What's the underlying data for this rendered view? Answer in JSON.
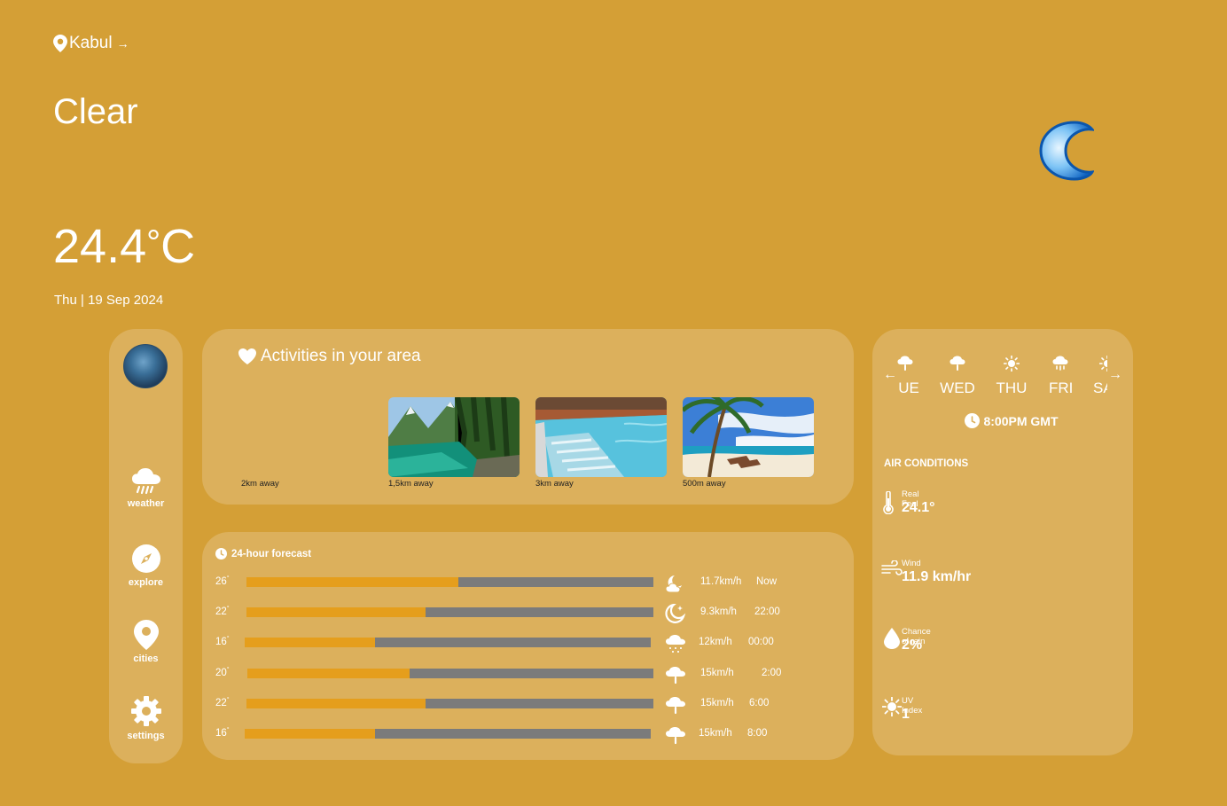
{
  "header": {
    "location": "Kabul",
    "condition": "Clear",
    "temperature": "24.4",
    "temperature_unit": "C",
    "date": "Thu | 19 Sep 2024"
  },
  "sidebar": {
    "items": [
      {
        "label": "weather",
        "icon": "rain-cloud-icon"
      },
      {
        "label": "explore",
        "icon": "compass-icon"
      },
      {
        "label": "cities",
        "icon": "map-pin-icon"
      },
      {
        "label": "settings",
        "icon": "gear-icon"
      }
    ]
  },
  "activities": {
    "title": "Activities in your area",
    "items": [
      {
        "distance": "2km away"
      },
      {
        "distance": "1,5km away"
      },
      {
        "distance": "3km away"
      },
      {
        "distance": "500m away"
      }
    ]
  },
  "forecast": {
    "title": "24-hour forecast",
    "rows": [
      {
        "temp": "26",
        "fill": 0.52,
        "wind": "11.7km/h",
        "time": "Now",
        "icon": "moon-cloud-icon"
      },
      {
        "temp": "22",
        "fill": 0.44,
        "wind": "9.3km/h",
        "time": "22:00",
        "icon": "moon-stars-icon"
      },
      {
        "temp": "16",
        "fill": 0.32,
        "wind": "12km/h",
        "time": "00:00",
        "icon": "snow-cloud-icon"
      },
      {
        "temp": "20",
        "fill": 0.4,
        "wind": "15km/h",
        "time": "2:00",
        "icon": "rain-cloud-icon"
      },
      {
        "temp": "22",
        "fill": 0.44,
        "wind": "15km/h",
        "time": "6:00",
        "icon": "rain-cloud-icon"
      },
      {
        "temp": "16",
        "fill": 0.32,
        "wind": "15km/h",
        "time": "8:00",
        "icon": "rain-cloud-icon"
      }
    ]
  },
  "week": {
    "days": [
      "UE",
      "WED",
      "THU",
      "FRI",
      "SA"
    ],
    "time": "8:00PM GMT"
  },
  "air": {
    "title": "AIR CONDITIONS",
    "real_feel_label": "Real Feel",
    "real_feel": "24.1°",
    "wind_label": "Wind",
    "wind": "11.9 km/hr",
    "rain_label": "Chance of rain",
    "rain": "2%",
    "uv_label": "UV Index",
    "uv": "1"
  },
  "colors": {
    "background": "#d49f36",
    "panel": "#dcb05c",
    "bar_fill": "#e59e1c",
    "bar_track": "#7b7b7b"
  }
}
